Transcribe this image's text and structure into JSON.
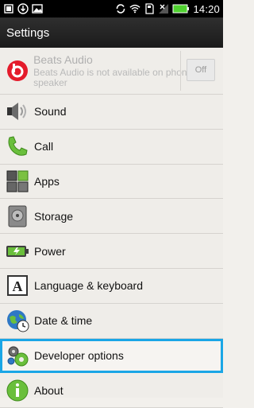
{
  "status_bar": {
    "time": "14:20",
    "icons": [
      "screenshot-icon",
      "download-icon",
      "image-icon",
      "sync-icon",
      "wifi-icon",
      "sd-card-icon",
      "signal-off-icon",
      "battery-icon"
    ]
  },
  "title_bar": {
    "title": "Settings"
  },
  "settings": {
    "beats": {
      "title": "Beats Audio",
      "subtitle": "Beats Audio is not available on phone speaker",
      "toggle": "Off"
    },
    "items": [
      {
        "label": "Sound",
        "icon": "speaker-icon"
      },
      {
        "label": "Call",
        "icon": "phone-icon"
      },
      {
        "label": "Apps",
        "icon": "apps-icon"
      },
      {
        "label": "Storage",
        "icon": "storage-icon"
      },
      {
        "label": "Power",
        "icon": "battery-icon"
      },
      {
        "label": "Language & keyboard",
        "icon": "language-icon"
      },
      {
        "label": "Date & time",
        "icon": "globe-clock-icon"
      },
      {
        "label": "Developer options",
        "icon": "gears-icon",
        "selected": true
      },
      {
        "label": "About",
        "icon": "info-icon"
      }
    ]
  },
  "colors": {
    "highlight": "#1aa6e6",
    "background": "#efede9"
  }
}
